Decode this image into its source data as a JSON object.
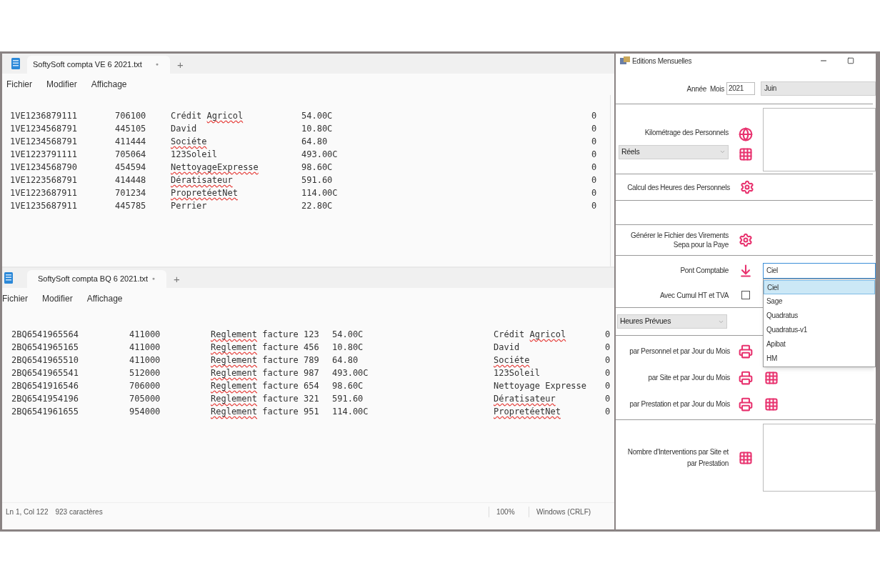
{
  "editors": [
    {
      "kind": "sales",
      "tab": {
        "title": "SoftySoft compta VE 6 2021.txt",
        "modified_marker": "●",
        "new_tab": "+"
      },
      "menu": [
        "Fichier",
        "Modifier",
        "Affichage"
      ],
      "rows": [
        {
          "code": "1VE1236879111",
          "account": "706100",
          "name": [
            {
              "text": "Crédit",
              "misspelled": false
            },
            {
              "text": "Agricol",
              "misspelled": true
            }
          ],
          "amount": "54.00C",
          "flag": "0"
        },
        {
          "code": "1VE1234568791",
          "account": "445105",
          "name": [
            {
              "text": "David",
              "misspelled": false
            }
          ],
          "amount": "10.80C",
          "flag": "0"
        },
        {
          "code": "1VE1234568791",
          "account": "411444",
          "name": [
            {
              "text": "Sociéte",
              "misspelled": true
            }
          ],
          "amount": "64.80",
          "flag": "0"
        },
        {
          "code": "1VE1223791111",
          "account": "705064",
          "name": [
            {
              "text": "123Soleil",
              "misspelled": false
            }
          ],
          "amount": "493.00C",
          "flag": "0"
        },
        {
          "code": "1VE1234568790",
          "account": "454594",
          "name": [
            {
              "text": "NettoyageExpresse",
              "misspelled": true
            }
          ],
          "amount": "98.60C",
          "flag": "0"
        },
        {
          "code": "1VE1223568791",
          "account": "414448",
          "name": [
            {
              "text": "Dératisateur",
              "misspelled": true
            }
          ],
          "amount": "591.60",
          "flag": "0"
        },
        {
          "code": "1VE1223687911",
          "account": "701234",
          "name": [
            {
              "text": "PropretéetNet",
              "misspelled": true
            }
          ],
          "amount": "114.00C",
          "flag": "0"
        },
        {
          "code": "1VE1235687911",
          "account": "445785",
          "name": [
            {
              "text": "Perrier",
              "misspelled": false
            }
          ],
          "amount": "22.80C",
          "flag": "0"
        }
      ]
    },
    {
      "kind": "bank",
      "tab": {
        "title": "SoftySoft compta BQ 6 2021.txt",
        "modified_marker": "●",
        "new_tab": "+"
      },
      "menu": [
        "Fichier",
        "Modifier",
        "Affichage"
      ],
      "rows": [
        {
          "code": "2BQ6541965564",
          "account": "411000",
          "label": [
            {
              "text": "Reglement",
              "misspelled": true
            },
            {
              "text": "facture 123",
              "misspelled": false
            }
          ],
          "amount": "54.00C",
          "name": [
            {
              "text": "Crédit",
              "misspelled": false
            },
            {
              "text": "Agricol",
              "misspelled": true
            }
          ],
          "flag": "0"
        },
        {
          "code": "2BQ6541965165",
          "account": "411000",
          "label": [
            {
              "text": "Reglement",
              "misspelled": true
            },
            {
              "text": "facture 456",
              "misspelled": false
            }
          ],
          "amount": "10.80C",
          "name": [
            {
              "text": "David",
              "misspelled": false
            }
          ],
          "flag": "0"
        },
        {
          "code": "2BQ6541965510",
          "account": "411000",
          "label": [
            {
              "text": "Reglement",
              "misspelled": true
            },
            {
              "text": "facture 789",
              "misspelled": false
            }
          ],
          "amount": "64.80",
          "name": [
            {
              "text": "Sociéte",
              "misspelled": true
            }
          ],
          "flag": "0"
        },
        {
          "code": "2BQ6541965541",
          "account": "512000",
          "label": [
            {
              "text": "Reglement",
              "misspelled": true
            },
            {
              "text": "facture 987",
              "misspelled": false
            }
          ],
          "amount": "493.00C",
          "name": [
            {
              "text": "123Soleil",
              "misspelled": false
            }
          ],
          "flag": "0"
        },
        {
          "code": "2BQ6541916546",
          "account": "706000",
          "label": [
            {
              "text": "Reglement",
              "misspelled": true
            },
            {
              "text": "facture 654",
              "misspelled": false
            }
          ],
          "amount": "98.60C",
          "name": [
            {
              "text": "Nettoyage Expresse",
              "misspelled": false
            }
          ],
          "flag": "0"
        },
        {
          "code": "2BQ6541954196",
          "account": "705000",
          "label": [
            {
              "text": "Reglement",
              "misspelled": true
            },
            {
              "text": "facture 321",
              "misspelled": false
            }
          ],
          "amount": "591.60",
          "name": [
            {
              "text": "Dératisateur",
              "misspelled": true
            }
          ],
          "flag": "0"
        },
        {
          "code": "2BQ6541961655",
          "account": "954000",
          "label": [
            {
              "text": "Reglement",
              "misspelled": true
            },
            {
              "text": "facture 951",
              "misspelled": false
            }
          ],
          "amount": "114.00C",
          "name": [
            {
              "text": "PropretéetNet",
              "misspelled": true
            }
          ],
          "flag": "0"
        }
      ],
      "status_bar": {
        "position": "Ln 1, Col 122",
        "characters": "923 caractères",
        "zoom": "100%",
        "line_endings": "Windows (CRLF)"
      }
    }
  ],
  "panel": {
    "title": "Editions Mensuelles",
    "period": {
      "year_label": "Année",
      "month_label": "Mois",
      "year": "2021",
      "month": "Juin"
    },
    "mileage": {
      "label": "Kilométrage des Personnels",
      "mode": "Réels"
    },
    "hours_calc": {
      "label": "Calcul des Heures des Personnels"
    },
    "sepa": {
      "label": "Générer le Fichier des Virements Sepa pour la Paye"
    },
    "accounting_bridge": {
      "label": "Pont Comptable",
      "value": "Ciel",
      "expanded": true,
      "options": [
        {
          "label": "Ciel",
          "selected": true
        },
        {
          "label": "Sage",
          "selected": false
        },
        {
          "label": "Quadratus",
          "selected": false
        },
        {
          "label": "Quadratus-v1",
          "selected": false
        },
        {
          "label": "Apibat",
          "selected": false
        },
        {
          "label": "HM",
          "selected": false
        }
      ]
    },
    "cumul": {
      "label": "Avec Cumul HT et TVA",
      "checked": false
    },
    "hours_type": {
      "value": "Heures Prévues"
    },
    "reports": [
      {
        "label": "par Personnel et par Jour du Mois"
      },
      {
        "label": "par Site et par Jour du Mois",
        "grid": true
      },
      {
        "label": "par Prestation et par Jour du Mois",
        "grid": true
      }
    ],
    "interventions": {
      "label": "Nombre d'Interventions par Site et par Prestation"
    }
  }
}
